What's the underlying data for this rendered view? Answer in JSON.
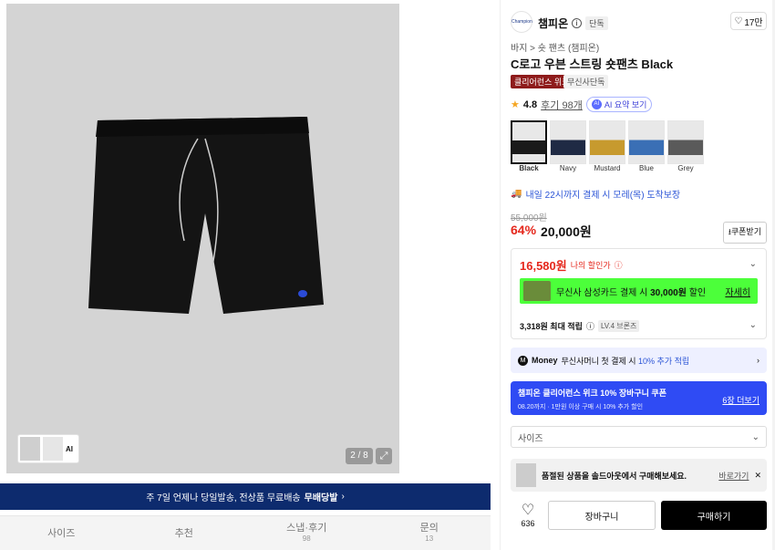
{
  "gallery": {
    "pager": "2 / 8",
    "thumb_ai": "AI"
  },
  "banner": {
    "text": "주 7일 언제나 당일발송, 전상품 무료배송",
    "badge": "무배당발",
    "chevron": "›"
  },
  "tabs": [
    {
      "label": "사이즈",
      "count": ""
    },
    {
      "label": "추천",
      "count": ""
    },
    {
      "label": "스냅·후기",
      "count": "98"
    },
    {
      "label": "문의",
      "count": "13"
    }
  ],
  "brand": {
    "logo_text": "Champion",
    "name": "챔피온",
    "tag": "단독"
  },
  "likes_top": "17만",
  "breadcrumb": "바지 > 숏 팬츠 (챔피온)",
  "product_title": "C로고 우븐 스트링 숏팬츠 Black",
  "badges": {
    "primary": "클리어런스 위크",
    "secondary": "무신사단독"
  },
  "rating": {
    "score": "4.8",
    "reviews": "후기 98개",
    "ai": "AI 요약 보기"
  },
  "colors": [
    {
      "name": "Black",
      "hex": "#1a1a1a"
    },
    {
      "name": "Navy",
      "hex": "#1f2a44"
    },
    {
      "name": "Mustard",
      "hex": "#c79a2e"
    },
    {
      "name": "Blue",
      "hex": "#3a6fb5"
    },
    {
      "name": "Grey",
      "hex": "#5a5a5a"
    }
  ],
  "delivery": "내일 22시까지 결제 시 모레(목) 도착보장",
  "price": {
    "original": "55,000원",
    "discount": "64%",
    "sale": "20,000원",
    "coupon": "쿠폰받기"
  },
  "my_price": {
    "value": "16,580원",
    "label": "나의 할인가"
  },
  "card_promo": {
    "text_pre": "무신사 삼성카드 결제 시 ",
    "amount": "30,000원",
    "text_post": " 할인",
    "link": "자세히"
  },
  "points": {
    "text": "3,318원 최대 적립",
    "level": "LV.4 브론즈"
  },
  "money": {
    "brand": "Money",
    "text_pre": "무신사머니 첫 결제 시 ",
    "highlight": "10% 추가 적립"
  },
  "coupon_banner": {
    "title": "챔피온 클리어런스 위크 10% 장바구니 쿠폰",
    "sub": "08.20까지 · 1만원 이상 구매 시 10% 추가 할인",
    "link": "6장 더보기"
  },
  "size_select": "사이즈",
  "soldout": {
    "text": "품절된 상품을 솔드아웃에서 구매해보세요.",
    "link": "바로가기"
  },
  "actions": {
    "likes": "636",
    "cart": "장바구니",
    "buy": "구매하기"
  }
}
